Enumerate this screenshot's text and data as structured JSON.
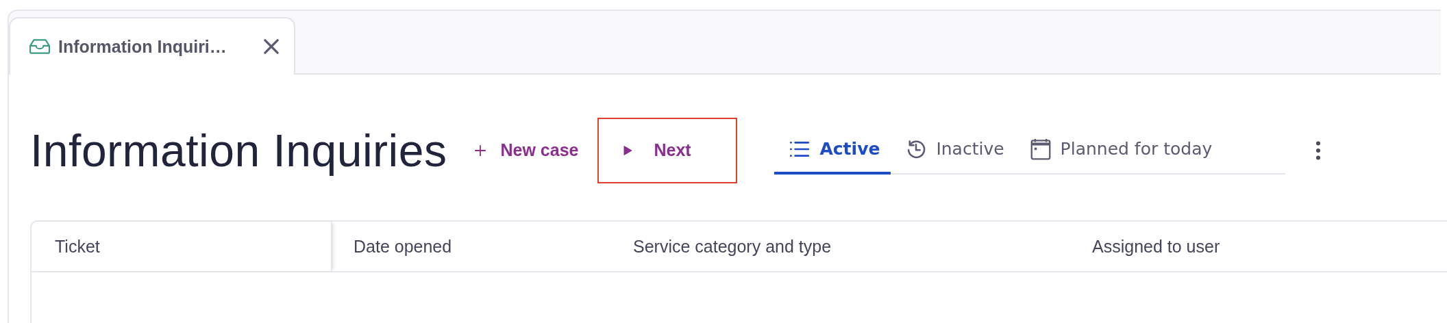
{
  "tabs": [
    {
      "label": "Information Inquiri…",
      "selected": true
    }
  ],
  "page_title": "Information Inquiries",
  "actions": [
    {
      "kind": "add",
      "label": "New case",
      "highlighted": false
    },
    {
      "kind": "play",
      "label": "Next",
      "highlighted": true
    }
  ],
  "view_tabs": [
    {
      "kind": "list",
      "label": "Active",
      "selected": true
    },
    {
      "kind": "history",
      "label": "Inactive",
      "selected": false
    },
    {
      "kind": "calendar",
      "label": "Planned for today",
      "selected": false
    }
  ],
  "table": {
    "columns": [
      "Ticket",
      "Date opened",
      "Service category and type",
      "Assigned to user"
    ]
  }
}
